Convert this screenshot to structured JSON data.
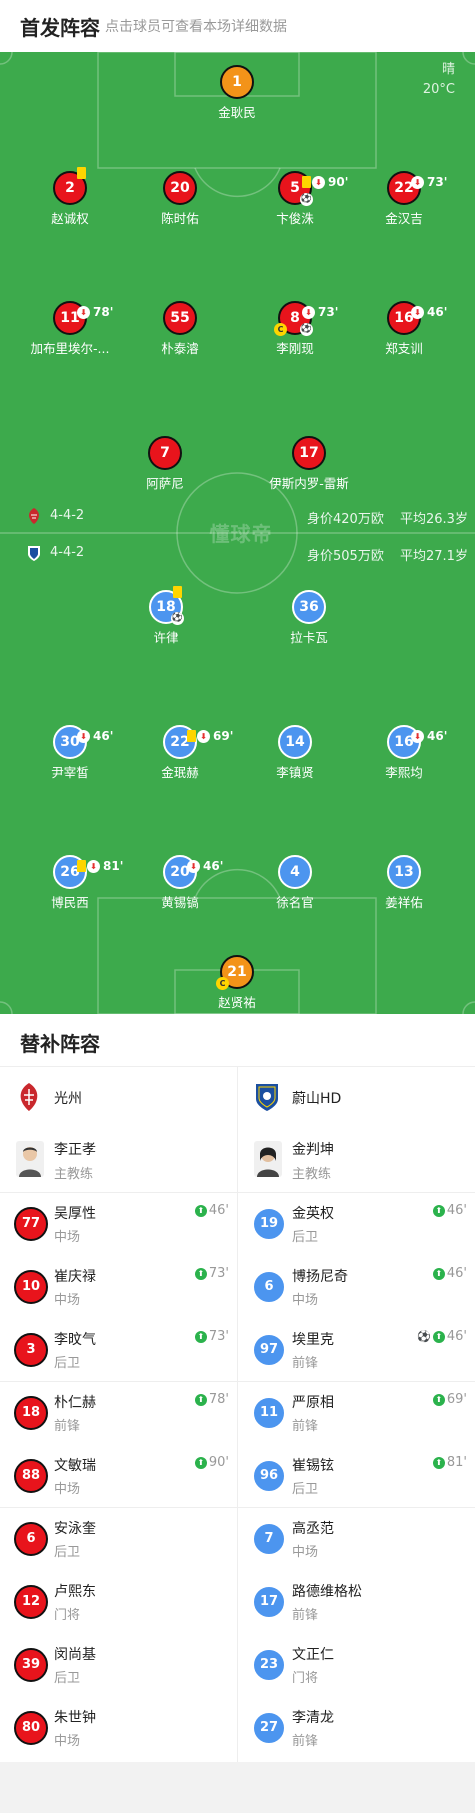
{
  "header": {
    "title": "首发阵容",
    "subtitle": "点击球员可查看本场详细数据"
  },
  "weather": {
    "condition": "晴",
    "temp": "20°C"
  },
  "watermark": "懂球帝",
  "home_info": {
    "formation": "4-4-2",
    "value": "身价420万欧",
    "avg_age": "平均26.3岁"
  },
  "away_info": {
    "formation": "4-4-2",
    "value": "身价505万欧",
    "avg_age": "平均27.1岁"
  },
  "home_players": [
    {
      "num": "1",
      "name": "金耿民",
      "color": "orng"
    },
    {
      "num": "2",
      "name": "赵诚权",
      "color": "red",
      "card": true
    },
    {
      "num": "20",
      "name": "陈时佑",
      "color": "red"
    },
    {
      "num": "5",
      "name": "卞俊洙",
      "color": "red",
      "card": true,
      "sub_out": "90'",
      "goal": true
    },
    {
      "num": "22",
      "name": "金汉吉",
      "color": "red",
      "sub_out": "73'"
    },
    {
      "num": "11",
      "name": "加布里埃尔-...",
      "color": "red",
      "sub_out": "78'"
    },
    {
      "num": "55",
      "name": "朴泰濬",
      "color": "red"
    },
    {
      "num": "8",
      "name": "李刚现",
      "color": "red",
      "sub_out": "73'",
      "captain": true,
      "ball": true
    },
    {
      "num": "16",
      "name": "郑支训",
      "color": "red",
      "sub_out": "46'"
    },
    {
      "num": "7",
      "name": "阿萨尼",
      "color": "red"
    },
    {
      "num": "17",
      "name": "伊斯内罗-雷斯",
      "color": "red"
    }
  ],
  "away_players": [
    {
      "num": "18",
      "name": "许律",
      "color": "blue",
      "card": true,
      "ball": true
    },
    {
      "num": "36",
      "name": "拉卡瓦",
      "color": "blue"
    },
    {
      "num": "30",
      "name": "尹宰皙",
      "color": "blue",
      "sub_out": "46'"
    },
    {
      "num": "22",
      "name": "金珉赫",
      "color": "blue",
      "card": true,
      "sub_out": "69'"
    },
    {
      "num": "14",
      "name": "李镇贤",
      "color": "blue"
    },
    {
      "num": "16",
      "name": "李熙均",
      "color": "blue",
      "sub_out": "46'"
    },
    {
      "num": "26",
      "name": "博民西",
      "color": "blue",
      "card": true,
      "sub_out": "81'"
    },
    {
      "num": "20",
      "name": "黄锡镐",
      "color": "blue",
      "sub_out": "46'"
    },
    {
      "num": "4",
      "name": "徐名官",
      "color": "blue"
    },
    {
      "num": "13",
      "name": "姜祥佑",
      "color": "blue"
    },
    {
      "num": "21",
      "name": "赵贤祐",
      "color": "orng",
      "captain": true
    }
  ],
  "bench": {
    "title": "替补阵容",
    "home": {
      "team": "光州",
      "coach": {
        "name": "李正孝",
        "role": "主教练"
      },
      "subs": [
        {
          "num": "77",
          "name": "吴厚性",
          "pos": "中场",
          "in": "46'"
        },
        {
          "num": "10",
          "name": "崔庆禄",
          "pos": "中场",
          "in": "73'"
        },
        {
          "num": "3",
          "name": "李旼气",
          "pos": "后卫",
          "in": "73'"
        },
        {
          "num": "18",
          "name": "朴仁赫",
          "pos": "前锋",
          "in": "78'"
        },
        {
          "num": "88",
          "name": "文敏瑞",
          "pos": "中场",
          "in": "90'"
        },
        {
          "num": "6",
          "name": "安泳奎",
          "pos": "后卫",
          "in": ""
        },
        {
          "num": "12",
          "name": "卢熙东",
          "pos": "门将",
          "in": ""
        },
        {
          "num": "39",
          "name": "闵尚基",
          "pos": "后卫",
          "in": ""
        },
        {
          "num": "80",
          "name": "朱世钟",
          "pos": "中场",
          "in": ""
        }
      ]
    },
    "away": {
      "team": "蔚山HD",
      "coach": {
        "name": "金判坤",
        "role": "主教练"
      },
      "subs": [
        {
          "num": "19",
          "name": "金英权",
          "pos": "后卫",
          "in": "46'"
        },
        {
          "num": "6",
          "name": "博扬尼奇",
          "pos": "中场",
          "in": "46'"
        },
        {
          "num": "97",
          "name": "埃里克",
          "pos": "前锋",
          "in": "46'",
          "goal": true
        },
        {
          "num": "11",
          "name": "严原相",
          "pos": "前锋",
          "in": "69'"
        },
        {
          "num": "96",
          "name": "崔锡铉",
          "pos": "后卫",
          "in": "81'"
        },
        {
          "num": "7",
          "name": "高丞范",
          "pos": "中场",
          "in": ""
        },
        {
          "num": "17",
          "name": "路德维格松",
          "pos": "前锋",
          "in": ""
        },
        {
          "num": "23",
          "name": "文正仁",
          "pos": "门将",
          "in": ""
        },
        {
          "num": "27",
          "name": "李清龙",
          "pos": "前锋",
          "in": ""
        }
      ]
    }
  },
  "colors": {
    "pitch": "#3daa4c",
    "home": "#e8141c",
    "away": "#4c95ef",
    "gk": "#f39319"
  }
}
